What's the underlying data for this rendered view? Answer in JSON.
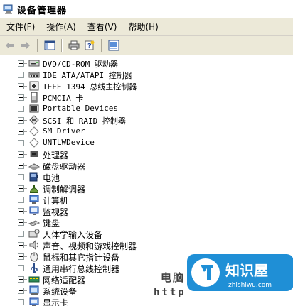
{
  "window": {
    "title": "设备管理器"
  },
  "menu": [
    {
      "label": "文件(F)"
    },
    {
      "label": "操作(A)"
    },
    {
      "label": "查看(V)"
    },
    {
      "label": "帮助(H)"
    }
  ],
  "toolbar": {
    "buttons": [
      "back-arrow-icon",
      "forward-arrow-icon",
      "console-tree-icon",
      "print-icon",
      "help-icon",
      "properties-icon"
    ]
  },
  "devices": [
    {
      "label": "DVD/CD-ROM 驱动器",
      "icon": "cdrom-icon"
    },
    {
      "label": "IDE ATA/ATAPI 控制器",
      "icon": "ide-controller-icon"
    },
    {
      "label": "IEEE 1394 总线主控制器",
      "icon": "ieee1394-icon"
    },
    {
      "label": "PCMCIA 卡",
      "icon": "pcmcia-icon"
    },
    {
      "label": "Portable Devices",
      "icon": "portable-device-icon"
    },
    {
      "label": "SCSI 和 RAID 控制器",
      "icon": "scsi-icon"
    },
    {
      "label": "SM Driver",
      "icon": "diamond-icon"
    },
    {
      "label": "UNTLWDevice",
      "icon": "diamond-icon"
    },
    {
      "label": "处理器",
      "icon": "processor-icon"
    },
    {
      "label": "磁盘驱动器",
      "icon": "disk-drive-icon"
    },
    {
      "label": "电池",
      "icon": "battery-icon"
    },
    {
      "label": "调制解调器",
      "icon": "modem-icon"
    },
    {
      "label": "计算机",
      "icon": "computer-icon"
    },
    {
      "label": "监视器",
      "icon": "monitor-icon"
    },
    {
      "label": "键盘",
      "icon": "keyboard-icon"
    },
    {
      "label": "人体学输入设备",
      "icon": "hid-icon"
    },
    {
      "label": "声音、视频和游戏控制器",
      "icon": "sound-icon"
    },
    {
      "label": "鼠标和其它指针设备",
      "icon": "mouse-icon"
    },
    {
      "label": "通用串行总线控制器",
      "icon": "usb-icon"
    },
    {
      "label": "网络适配器",
      "icon": "network-adapter-icon"
    },
    {
      "label": "系统设备",
      "icon": "system-device-icon"
    },
    {
      "label": "显示卡",
      "icon": "display-adapter-icon"
    }
  ],
  "watermark": {
    "line1": "电脑 网",
    "line2": "http ",
    "logo_text": "知识屋",
    "logo_sub": "zhishiwu.com"
  },
  "colors": {
    "menubar": "#ece9d8",
    "logo_blue": "#1f8fd6"
  }
}
